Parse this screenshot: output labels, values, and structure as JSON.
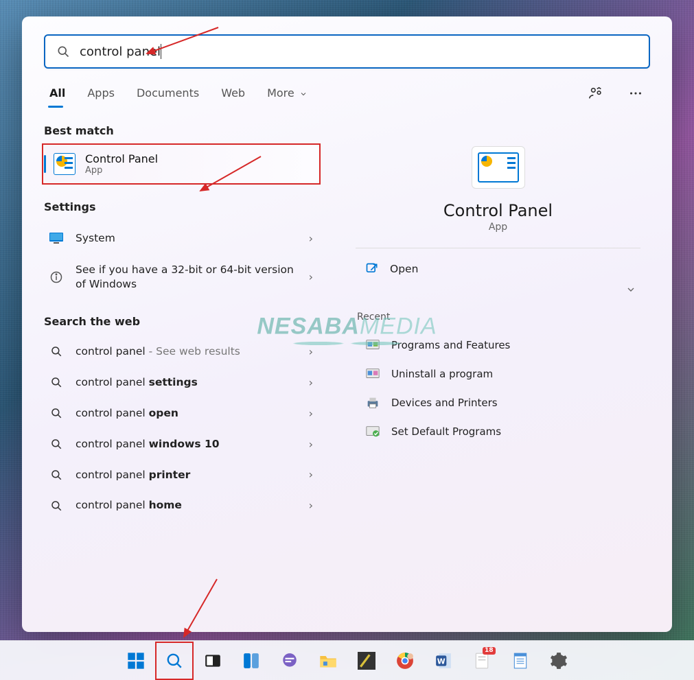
{
  "search": {
    "value": "control panel"
  },
  "tabs": {
    "all": "All",
    "apps": "Apps",
    "documents": "Documents",
    "web": "Web",
    "more": "More"
  },
  "sections": {
    "best_match": "Best match",
    "settings": "Settings",
    "search_web": "Search the web"
  },
  "best_match": {
    "title": "Control Panel",
    "subtitle": "App"
  },
  "settings_items": [
    {
      "label": "System"
    },
    {
      "label": "See if you have a 32-bit or 64-bit version of Windows"
    }
  ],
  "web_items": [
    {
      "prefix": "control panel",
      "suffix": " - See web results",
      "bold": ""
    },
    {
      "prefix": "control panel ",
      "suffix": "",
      "bold": "settings"
    },
    {
      "prefix": "control panel ",
      "suffix": "",
      "bold": "open"
    },
    {
      "prefix": "control panel ",
      "suffix": "",
      "bold": "windows 10"
    },
    {
      "prefix": "control panel ",
      "suffix": "",
      "bold": "printer"
    },
    {
      "prefix": "control panel ",
      "suffix": "",
      "bold": "home"
    }
  ],
  "detail": {
    "title": "Control Panel",
    "subtitle": "App",
    "open": "Open",
    "recent_label": "Recent",
    "recent": [
      "Programs and Features",
      "Uninstall a program",
      "Devices and Printers",
      "Set Default Programs"
    ]
  },
  "taskbar": {
    "badge": "18"
  },
  "watermark": {
    "a": "NESABA",
    "b": "MEDIA"
  }
}
